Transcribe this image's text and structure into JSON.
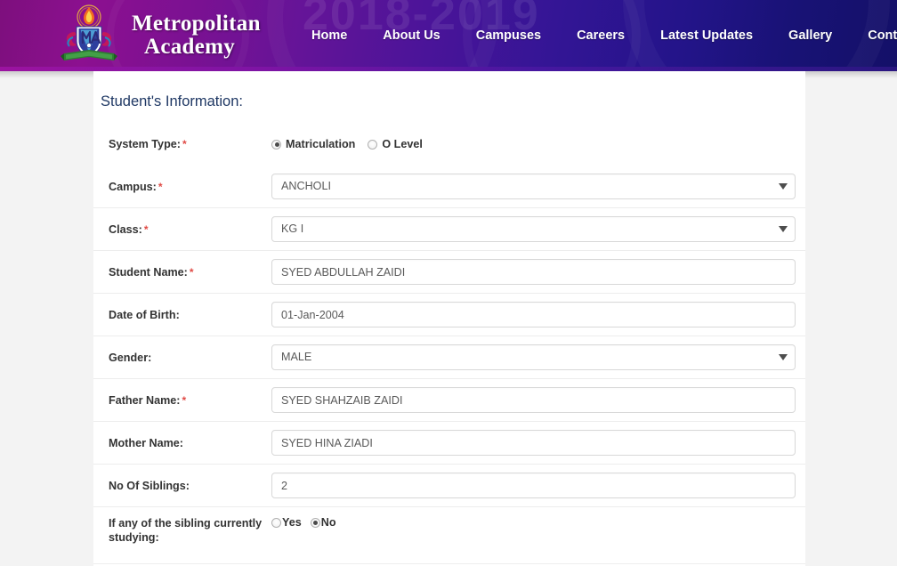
{
  "header": {
    "brand_line1": "Metropolitan",
    "brand_line2": "Academy",
    "background_year": "2018-2019",
    "logo_icon": "academy-crest-icon",
    "gradient_start": "#7d0f7d",
    "gradient_end": "#141068",
    "nav": [
      {
        "label": "Home"
      },
      {
        "label": "About Us"
      },
      {
        "label": "Campuses"
      },
      {
        "label": "Careers"
      },
      {
        "label": "Latest Updates"
      },
      {
        "label": "Gallery"
      },
      {
        "label": "Contact Us"
      }
    ]
  },
  "form": {
    "section_title": "Student's Information:",
    "required_marker": "*",
    "accent_color": "#1f3864",
    "required_color": "#e04a45",
    "rows": {
      "system_type": {
        "label": "System Type:",
        "required": true,
        "options": [
          {
            "label": "Matriculation",
            "selected": true
          },
          {
            "label": "O Level",
            "selected": false
          }
        ]
      },
      "campus": {
        "label": "Campus:",
        "required": true,
        "value": "ANCHOLI"
      },
      "class": {
        "label": "Class:",
        "required": true,
        "value": "KG I"
      },
      "student_name": {
        "label": "Student Name:",
        "required": true,
        "value": "SYED ABDULLAH ZAIDI"
      },
      "date_of_birth": {
        "label": "Date of Birth:",
        "required": false,
        "value": "01-Jan-2004"
      },
      "gender": {
        "label": "Gender:",
        "required": false,
        "value": "MALE"
      },
      "father_name": {
        "label": "Father Name:",
        "required": true,
        "value": "SYED SHAHZAIB ZAIDI"
      },
      "mother_name": {
        "label": "Mother Name:",
        "required": false,
        "value": "SYED HINA ZIADI"
      },
      "no_of_siblings": {
        "label": "No Of Siblings:",
        "required": false,
        "value": "2"
      },
      "sibling_studying": {
        "label": "If any of the sibling currently studying:",
        "required": false,
        "options": [
          {
            "label": "Yes",
            "selected": false
          },
          {
            "label": "No",
            "selected": true
          }
        ]
      }
    }
  }
}
